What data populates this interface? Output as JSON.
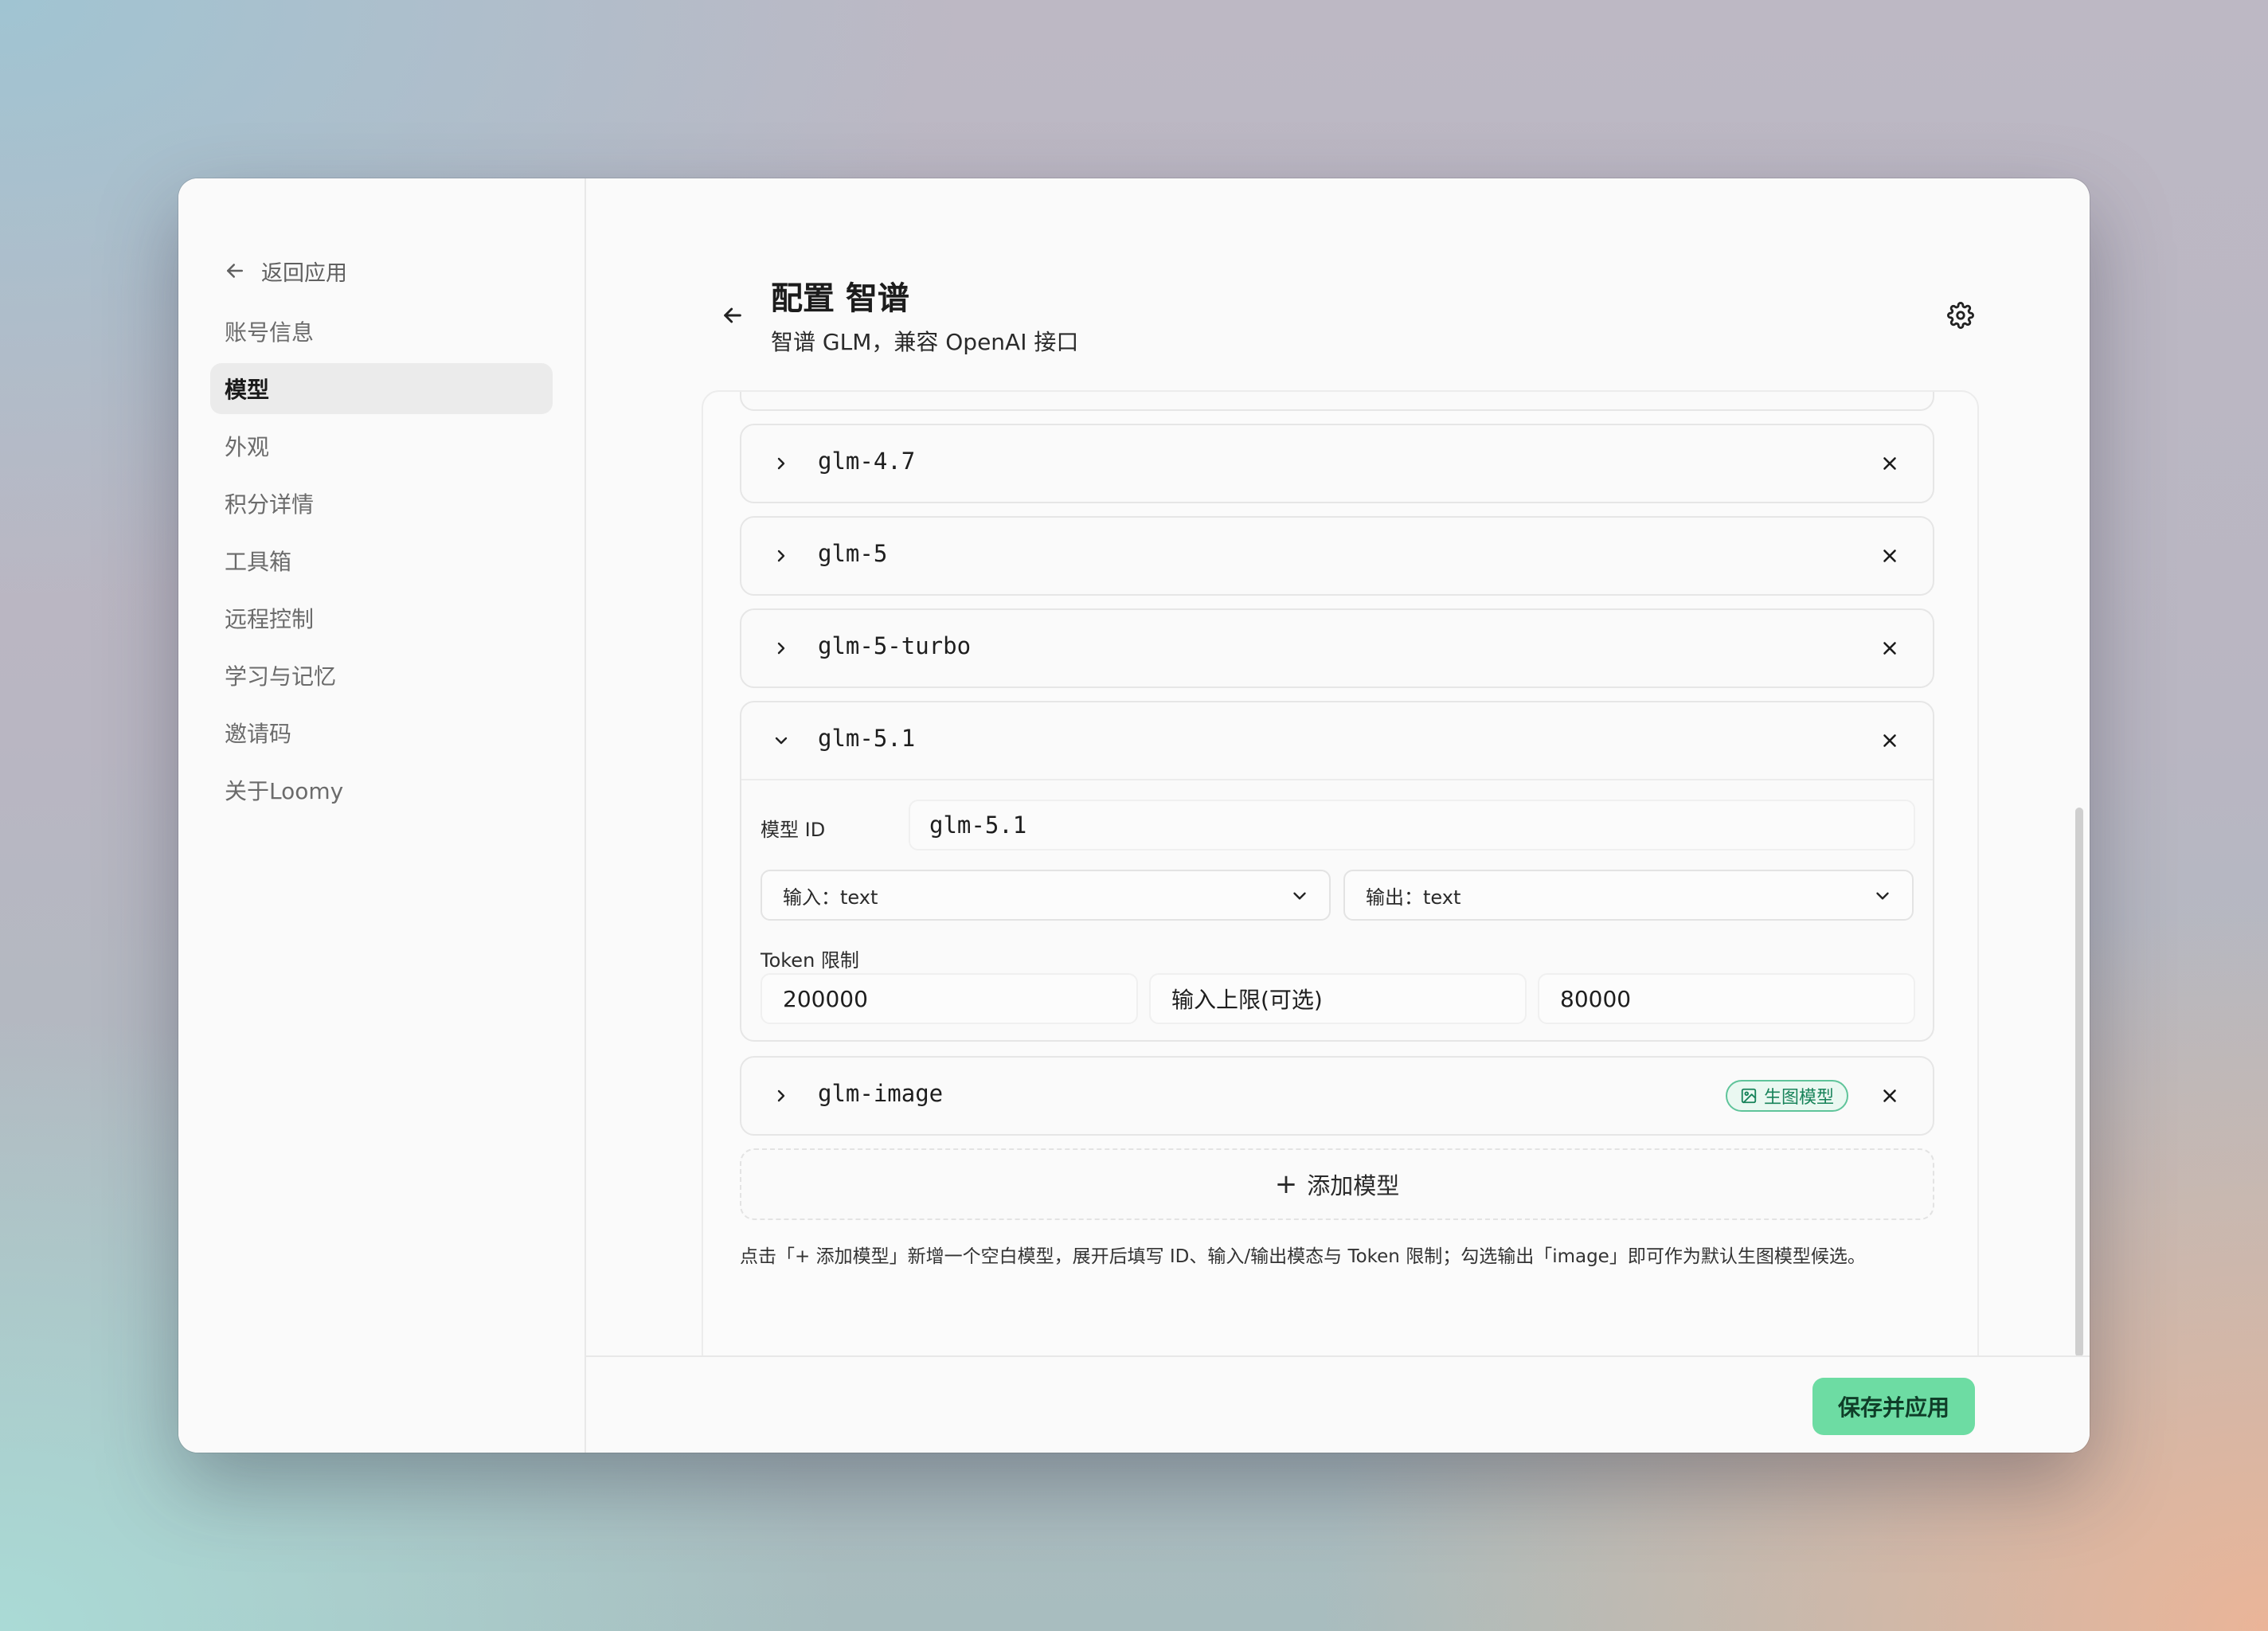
{
  "window": {
    "traffic_lights": [
      "close",
      "minimize",
      "maximize"
    ]
  },
  "sidebar": {
    "back_label": "返回应用",
    "items": [
      {
        "label": "账号信息",
        "active": false
      },
      {
        "label": "模型",
        "active": true
      },
      {
        "label": "外观",
        "active": false
      },
      {
        "label": "积分详情",
        "active": false
      },
      {
        "label": "工具箱",
        "active": false
      },
      {
        "label": "远程控制",
        "active": false
      },
      {
        "label": "学习与记忆",
        "active": false
      },
      {
        "label": "邀请码",
        "active": false
      },
      {
        "label": "关于Loomy",
        "active": false
      }
    ]
  },
  "header": {
    "title": "配置 智谱",
    "subtitle": "智谱 GLM，兼容 OpenAI 接口"
  },
  "models": [
    {
      "name": "glm-4.7",
      "expanded": false
    },
    {
      "name": "glm-5",
      "expanded": false
    },
    {
      "name": "glm-5-turbo",
      "expanded": false
    },
    {
      "name": "glm-5.1",
      "expanded": true,
      "id_label": "模型 ID",
      "id_value": "glm-5.1",
      "input_select": "输入：text",
      "output_select": "输出：text",
      "token_label": "Token 限制",
      "context_limit": "200000",
      "input_limit_placeholder": "输入上限(可选)",
      "output_limit": "80000"
    },
    {
      "name": "glm-image",
      "expanded": false,
      "badge": "生图模型"
    }
  ],
  "add_model_label": "添加模型",
  "hint": "点击「+ 添加模型」新增一个空白模型，展开后填写 ID、输入/输出模态与 Token 限制；勾选输出「image」即可作为默认生图模型候选。",
  "footer": {
    "save_label": "保存并应用"
  },
  "colors": {
    "accent": "#6ddca3",
    "badge_green": "#18835a",
    "active_nav_bg": "#ebebeb"
  }
}
